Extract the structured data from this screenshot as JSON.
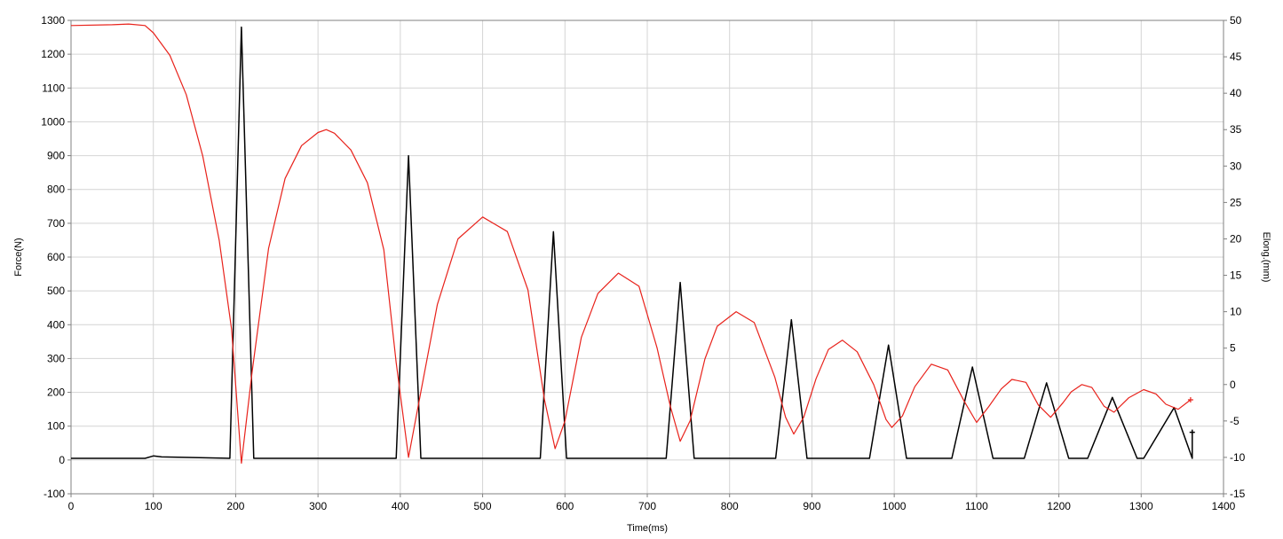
{
  "chart_data": {
    "type": "line",
    "xlabel": "Time(ms)",
    "ylabel_left": "Force(N)",
    "ylabel_right": "Elong.(mm)",
    "xlim": [
      0,
      1400
    ],
    "ylim_left": [
      -100,
      1300
    ],
    "ylim_right": [
      -15,
      50
    ],
    "x_ticks": [
      0,
      100,
      200,
      300,
      400,
      500,
      600,
      700,
      800,
      900,
      1000,
      1100,
      1200,
      1300,
      1400
    ],
    "y_ticks_left": [
      -100,
      0,
      100,
      200,
      300,
      400,
      500,
      600,
      700,
      800,
      900,
      1000,
      1100,
      1200,
      1300
    ],
    "y_ticks_right": [
      -15,
      -10,
      -5,
      0,
      5,
      10,
      15,
      20,
      25,
      30,
      35,
      40,
      45,
      50
    ],
    "grid": true,
    "series": [
      {
        "axis": "left",
        "color": "#000000",
        "baseline": 5,
        "peaks": [
          {
            "start": 193,
            "peak": 207,
            "end": 222,
            "value": 1280
          },
          {
            "start": 395,
            "peak": 410,
            "end": 425,
            "value": 900
          },
          {
            "start": 570,
            "peak": 586,
            "end": 602,
            "value": 675
          },
          {
            "start": 723,
            "peak": 740,
            "end": 757,
            "value": 525
          },
          {
            "start": 856,
            "peak": 875,
            "end": 894,
            "value": 415
          },
          {
            "start": 970,
            "peak": 993,
            "end": 1015,
            "value": 340
          },
          {
            "start": 1070,
            "peak": 1095,
            "end": 1120,
            "value": 275
          },
          {
            "start": 1158,
            "peak": 1185,
            "end": 1212,
            "value": 228
          },
          {
            "start": 1235,
            "peak": 1265,
            "end": 1295,
            "value": 185
          },
          {
            "start": 1303,
            "peak": 1340,
            "end": 1362,
            "value": 155
          }
        ],
        "end_point": [
          1362,
          82
        ]
      },
      {
        "axis": "right",
        "color": "#e8221b",
        "points": [
          [
            0,
            49.3
          ],
          [
            50,
            49.4
          ],
          [
            70,
            49.5
          ],
          [
            90,
            49.3
          ],
          [
            100,
            48.3
          ],
          [
            120,
            45.2
          ],
          [
            140,
            39.8
          ],
          [
            160,
            31.4
          ],
          [
            180,
            19.8
          ],
          [
            195,
            7.6
          ],
          [
            207,
            -10.8
          ],
          [
            220,
            1.8
          ],
          [
            240,
            18.7
          ],
          [
            260,
            28.3
          ],
          [
            280,
            32.8
          ],
          [
            300,
            34.6
          ],
          [
            310,
            35.0
          ],
          [
            320,
            34.5
          ],
          [
            340,
            32.2
          ],
          [
            360,
            27.7
          ],
          [
            380,
            18.5
          ],
          [
            395,
            3.0
          ],
          [
            410,
            -10.0
          ],
          [
            425,
            -1.0
          ],
          [
            445,
            11.0
          ],
          [
            470,
            20.0
          ],
          [
            500,
            23.0
          ],
          [
            530,
            21.0
          ],
          [
            555,
            13.0
          ],
          [
            575,
            -2.0
          ],
          [
            588,
            -8.8
          ],
          [
            600,
            -5.0
          ],
          [
            620,
            6.5
          ],
          [
            640,
            12.5
          ],
          [
            665,
            15.3
          ],
          [
            690,
            13.5
          ],
          [
            712,
            5.0
          ],
          [
            728,
            -3.0
          ],
          [
            740,
            -7.8
          ],
          [
            752,
            -5.0
          ],
          [
            770,
            3.5
          ],
          [
            785,
            8.0
          ],
          [
            808,
            10.0
          ],
          [
            830,
            8.5
          ],
          [
            855,
            1.0
          ],
          [
            868,
            -4.5
          ],
          [
            878,
            -6.8
          ],
          [
            890,
            -4.5
          ],
          [
            905,
            0.8
          ],
          [
            920,
            4.8
          ],
          [
            937,
            6.1
          ],
          [
            955,
            4.5
          ],
          [
            975,
            0.0
          ],
          [
            990,
            -4.8
          ],
          [
            997,
            -5.9
          ],
          [
            1010,
            -4.3
          ],
          [
            1025,
            -0.3
          ],
          [
            1045,
            2.8
          ],
          [
            1065,
            2.0
          ],
          [
            1085,
            -2.3
          ],
          [
            1100,
            -5.2
          ],
          [
            1115,
            -3.0
          ],
          [
            1130,
            -0.6
          ],
          [
            1143,
            0.7
          ],
          [
            1160,
            0.3
          ],
          [
            1175,
            -2.8
          ],
          [
            1190,
            -4.5
          ],
          [
            1205,
            -2.5
          ],
          [
            1215,
            -1.0
          ],
          [
            1228,
            0.0
          ],
          [
            1240,
            -0.4
          ],
          [
            1255,
            -3.0
          ],
          [
            1267,
            -3.8
          ],
          [
            1285,
            -1.8
          ],
          [
            1303,
            -0.7
          ],
          [
            1318,
            -1.3
          ],
          [
            1330,
            -2.7
          ],
          [
            1345,
            -3.4
          ],
          [
            1360,
            -2.1
          ]
        ]
      }
    ]
  }
}
